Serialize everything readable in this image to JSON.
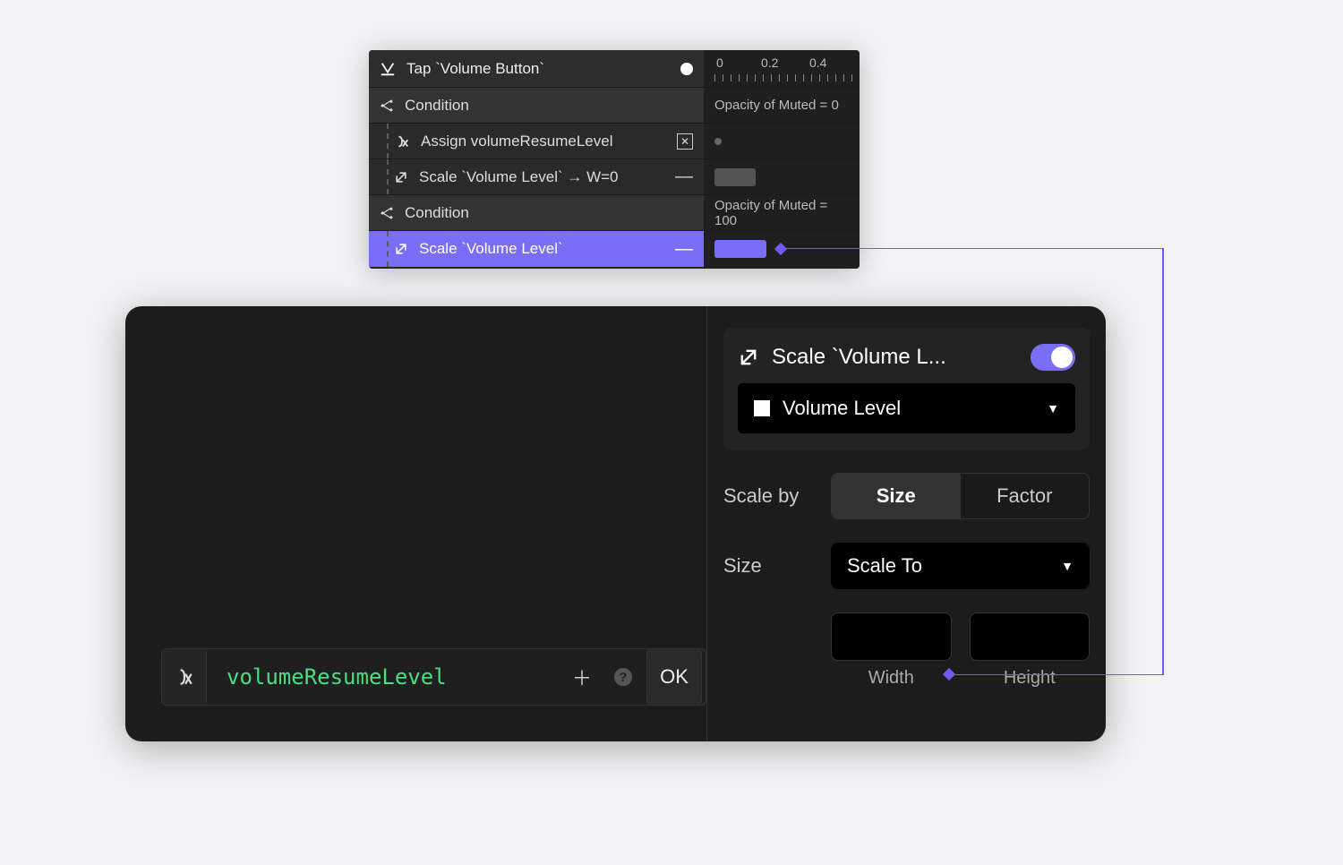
{
  "timeline": {
    "header": {
      "title": "Tap `Volume Button`"
    },
    "ruler": [
      "0",
      "0.2",
      "0.4"
    ],
    "rows": [
      {
        "type": "cond",
        "label": "Condition",
        "right": "Opacity of Muted = 0"
      },
      {
        "type": "assign",
        "label": "Assign volumeResumeLevel",
        "right": ""
      },
      {
        "type": "scale0",
        "label": "Scale `Volume Level` → W=0",
        "right": ""
      },
      {
        "type": "cond2",
        "label": "Condition",
        "right": "Opacity of Muted = 100"
      },
      {
        "type": "scale",
        "label": "Scale `Volume Level`",
        "right": ""
      }
    ]
  },
  "inspector": {
    "formula": {
      "value": "volumeResumeLevel",
      "ok": "OK"
    },
    "card": {
      "title": "Scale `Volume L...",
      "target": "Volume Level"
    },
    "scaleBy": {
      "label": "Scale by",
      "options": [
        "Size",
        "Factor"
      ],
      "active": "Size"
    },
    "size": {
      "label": "Size",
      "mode": "Scale To"
    },
    "wh": {
      "width": "Width",
      "height": "Height"
    }
  }
}
